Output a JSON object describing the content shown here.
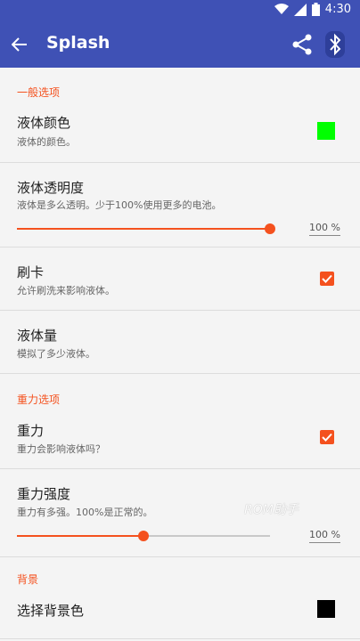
{
  "status": {
    "time": "4:30"
  },
  "app": {
    "title": "Splash"
  },
  "sections": [
    {
      "label": "一般选项"
    },
    {
      "label": "重力选项"
    },
    {
      "label": "背景"
    }
  ],
  "items": {
    "liquid_color": {
      "title": "液体颜色",
      "subtitle": "液体的颜色。",
      "color": "#00ff00"
    },
    "liquid_opacity": {
      "title": "液体透明度",
      "subtitle": "液体是多么透明。少于100%使用更多的电池。",
      "value": 100,
      "value_label": "100 %"
    },
    "swipe": {
      "title": "刷卡",
      "subtitle": "允许刷洗来影响液体。",
      "checked": true
    },
    "liquid_amount": {
      "title": "液体量",
      "subtitle": "模拟了多少液体。"
    },
    "gravity": {
      "title": "重力",
      "subtitle": "重力会影响液体吗？",
      "checked": true
    },
    "gravity_strength": {
      "title": "重力强度",
      "subtitle": "重力有多强。100%是正常的。",
      "value": 50,
      "value_label": "100 %"
    },
    "background_color": {
      "title": "选择背景色",
      "color": "#000000"
    }
  },
  "watermark": "ROM助手",
  "colors": {
    "primary": "#3f51b5",
    "accent": "#f4511e"
  },
  "icons": [
    "wifi-icon",
    "signal-icon",
    "battery-icon",
    "back-arrow-icon",
    "share-icon",
    "bluetooth-icon",
    "check-icon"
  ]
}
